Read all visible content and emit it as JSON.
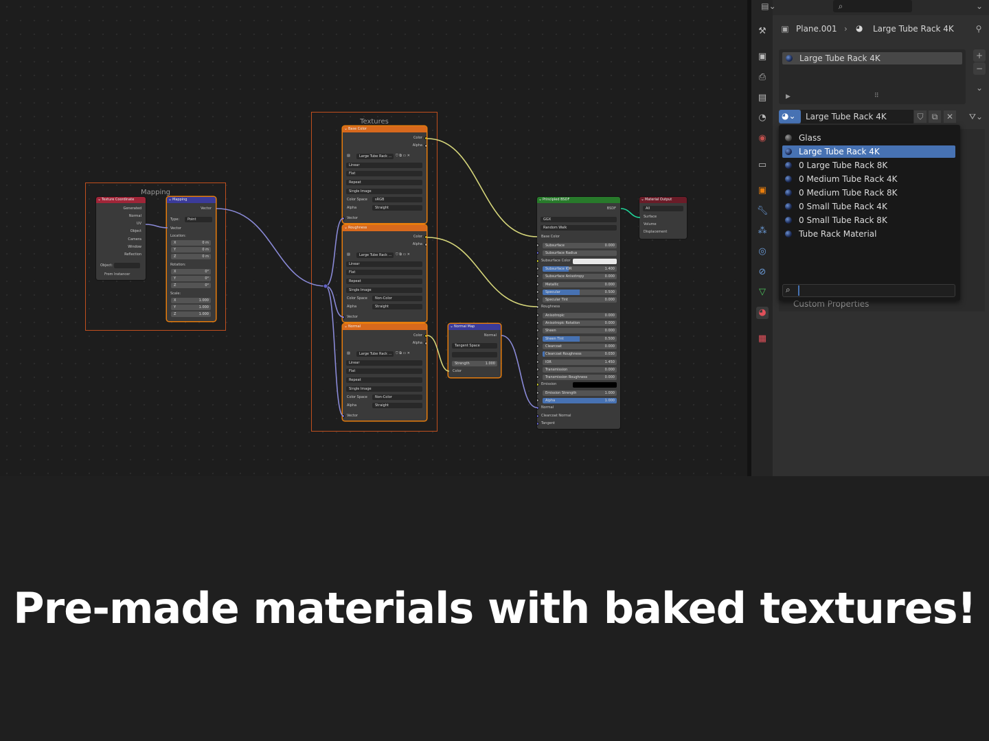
{
  "node_editor": {
    "frame_mapping_label": "Mapping",
    "frame_textures_label": "Textures",
    "texcoord": {
      "title": "Texture Coordinate",
      "outputs": [
        "Generated",
        "Normal",
        "UV",
        "Object",
        "Camera",
        "Window",
        "Reflection"
      ],
      "object_label": "Object:",
      "from_instancer": "From Instancer"
    },
    "mapping": {
      "title": "Mapping",
      "output": "Vector",
      "type_label": "Type:",
      "type_value": "Point",
      "vector_label": "Vector",
      "location_label": "Location:",
      "location": [
        {
          "axis": "X",
          "value": "0 m"
        },
        {
          "axis": "Y",
          "value": "0 m"
        },
        {
          "axis": "Z",
          "value": "0 m"
        }
      ],
      "rotation_label": "Rotation:",
      "rotation": [
        {
          "axis": "X",
          "value": "0°"
        },
        {
          "axis": "Y",
          "value": "0°"
        },
        {
          "axis": "Z",
          "value": "0°"
        }
      ],
      "scale_label": "Scale:",
      "scale": [
        {
          "axis": "X",
          "value": "1.000"
        },
        {
          "axis": "Y",
          "value": "1.000"
        },
        {
          "axis": "Z",
          "value": "1.000"
        }
      ]
    },
    "image_nodes": [
      {
        "title": "Base Color",
        "image": "Large Tube Rack ...",
        "interp": "Linear",
        "proj": "Flat",
        "ext": "Repeat",
        "source": "Single Image",
        "cs_label": "Color Space",
        "cs_value": "sRGB",
        "alpha_label": "Alpha",
        "alpha_value": "Straight",
        "out_color": "Color",
        "out_alpha": "Alpha",
        "in_vector": "Vector"
      },
      {
        "title": "Roughness",
        "image": "Large Tube Rack ...",
        "interp": "Linear",
        "proj": "Flat",
        "ext": "Repeat",
        "source": "Single Image",
        "cs_label": "Color Space",
        "cs_value": "Non-Color",
        "alpha_label": "Alpha",
        "alpha_value": "Straight",
        "out_color": "Color",
        "out_alpha": "Alpha",
        "in_vector": "Vector"
      },
      {
        "title": "Normal",
        "image": "Large Tube Rack ...",
        "interp": "Linear",
        "proj": "Flat",
        "ext": "Repeat",
        "source": "Single Image",
        "cs_label": "Color Space",
        "cs_value": "Non-Color",
        "alpha_label": "Alpha",
        "alpha_value": "Straight",
        "out_color": "Color",
        "out_alpha": "Alpha",
        "in_vector": "Vector"
      }
    ],
    "normal_map": {
      "title": "Normal Map",
      "output": "Normal",
      "space": "Tangent Space",
      "strength_label": "Strength",
      "strength_value": "1.000",
      "input_color": "Color"
    },
    "bsdf": {
      "title": "Principled BSDF",
      "output": "BSDF",
      "distribution": "GGX",
      "subsurface_method": "Random Walk",
      "base_color": "Base Color",
      "fields": [
        {
          "label": "Subsurface",
          "value": "0.000",
          "fill": 0
        },
        {
          "label": "Subsurface Radius",
          "value": "",
          "fill": 0
        },
        {
          "label": "Subsurface Color",
          "value": "",
          "fill": 0
        },
        {
          "label": "Subsurface IOR",
          "value": "1.400",
          "fill": 0.35
        },
        {
          "label": "Subsurface Anisotropy",
          "value": "0.000",
          "fill": 0
        },
        {
          "label": "Metallic",
          "value": "0.000",
          "fill": 0
        },
        {
          "label": "Specular",
          "value": "0.500",
          "fill": 0.5
        },
        {
          "label": "Specular Tint",
          "value": "0.000",
          "fill": 0
        },
        {
          "label": "Roughness",
          "value": "",
          "fill": 0
        },
        {
          "label": "Anisotropic",
          "value": "0.000",
          "fill": 0
        },
        {
          "label": "Anisotropic Rotation",
          "value": "0.000",
          "fill": 0
        },
        {
          "label": "Sheen",
          "value": "0.000",
          "fill": 0
        },
        {
          "label": "Sheen Tint",
          "value": "0.500",
          "fill": 0.5
        },
        {
          "label": "Clearcoat",
          "value": "0.000",
          "fill": 0
        },
        {
          "label": "Clearcoat Roughness",
          "value": "0.030",
          "fill": 0.03
        },
        {
          "label": "IOR",
          "value": "1.450",
          "fill": 0
        },
        {
          "label": "Transmission",
          "value": "0.000",
          "fill": 0
        },
        {
          "label": "Transmission Roughness",
          "value": "0.000",
          "fill": 0
        },
        {
          "label": "Emission",
          "value": "",
          "fill": 0
        },
        {
          "label": "Emission Strength",
          "value": "1.000",
          "fill": 0
        },
        {
          "label": "Alpha",
          "value": "1.000",
          "fill": 1
        },
        {
          "label": "Normal",
          "value": "",
          "fill": 0
        },
        {
          "label": "Clearcoat Normal",
          "value": "",
          "fill": 0
        },
        {
          "label": "Tangent",
          "value": "",
          "fill": 0
        }
      ]
    },
    "output_node": {
      "title": "Material Output",
      "target": "All",
      "inputs": [
        "Surface",
        "Volume",
        "Displacement"
      ]
    }
  },
  "properties": {
    "breadcrumb_object": "Plane.001",
    "breadcrumb_material": "Large Tube Rack 4K",
    "slot_name": "Large Tube Rack 4K",
    "material_field": "Large Tube Rack 4K",
    "custom_properties": "Custom Properties",
    "browse_items": [
      "Glass",
      "Large Tube Rack 4K",
      "0 Large Tube Rack 8K",
      "0 Medium Tube Rack 4K",
      "0 Medium Tube Rack 8K",
      "0 Small Tube Rack 4K",
      "0 Small Tube Rack 8K",
      "Tube Rack Material"
    ],
    "selected_index": 1,
    "search_placeholder": ""
  },
  "caption": "Pre-made materials with baked textures!",
  "colors": {
    "frame": "#c2501e",
    "texture_header": "#d8691d",
    "input_header": "#a02538",
    "vector_header": "#3b3b9a",
    "shader_header": "#287a2b",
    "output_header": "#6b1c28",
    "selection": "#4772b3"
  }
}
